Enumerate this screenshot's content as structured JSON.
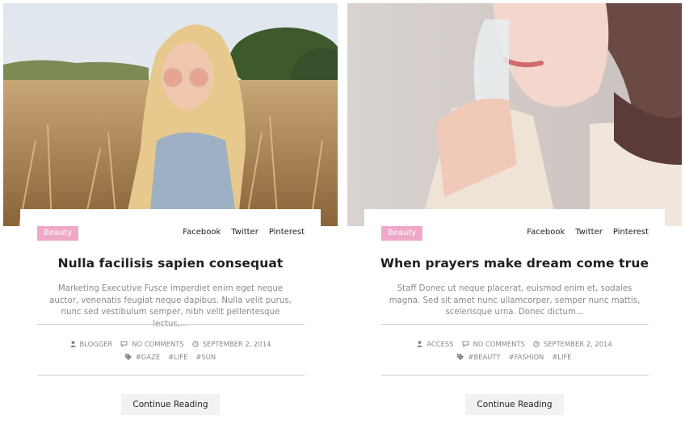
{
  "posts": [
    {
      "category": "Beauty",
      "share": [
        "Facebook",
        "Twitter",
        "Pinterest"
      ],
      "title": "Nulla facilisis sapien consequat",
      "excerpt": "Marketing Executive Fusce imperdiet enim eget neque auctor, venenatis feugiat neque dapibus. Nulla velit purus, nunc sed vestibulum semper, nibh velit pellentesque lectus,...",
      "author": "BLOGGER",
      "comments": "NO COMMENTS",
      "date": "SEPTEMBER 2, 2014",
      "tags": [
        "#GAZE",
        "#LIFE",
        "#SUN"
      ],
      "button": "Continue Reading"
    },
    {
      "category": "Beauty",
      "share": [
        "Facebook",
        "Twitter",
        "Pinterest"
      ],
      "title": "When prayers make dream come true",
      "excerpt": "Staff Donec ut neque placerat, euismod enim et, sodales magna. Sed sit amet nunc ullamcorper, semper nunc mattis, scelerisque urna. Donec dictum...",
      "author": "ACCESS",
      "comments": "NO COMMENTS",
      "date": "SEPTEMBER 2, 2014",
      "tags": [
        "#BEAUTY",
        "#FASHION",
        "#LIFE"
      ],
      "button": "Continue Reading"
    }
  ],
  "colors": {
    "badge": "#f0a8c8",
    "button_bg": "#f2f2f2",
    "muted_text": "#8a8a8a"
  }
}
